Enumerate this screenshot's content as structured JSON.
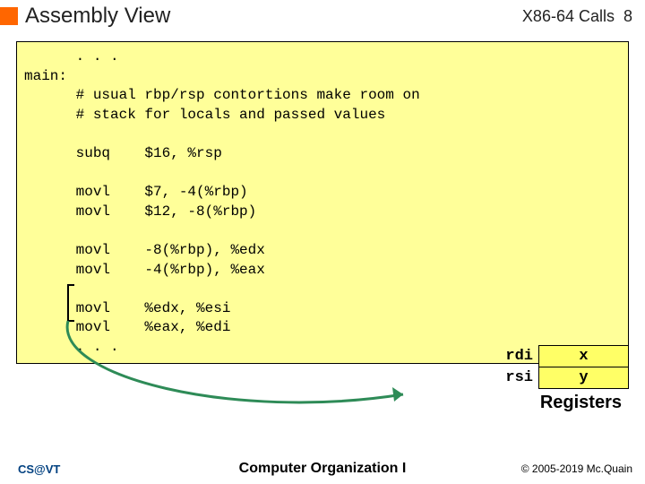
{
  "header": {
    "title": "Assembly View",
    "topic": "X86-64 Calls",
    "page": "8"
  },
  "code": {
    "lines": "      . . .\nmain:\n      # usual rbp/rsp contortions make room on\n      # stack for locals and passed values\n\n      subq    $16, %rsp\n\n      movl    $7, -4(%rbp)\n      movl    $12, -8(%rbp)\n\n      movl    -8(%rbp), %edx\n      movl    -4(%rbp), %eax\n\n      movl    %edx, %esi\n      movl    %eax, %edi\n      . . ."
  },
  "registers": {
    "label": "Registers",
    "rows": [
      {
        "reg": "rdi",
        "val": "x"
      },
      {
        "reg": "rsi",
        "val": "y"
      }
    ]
  },
  "footer": {
    "left": "CS@VT",
    "center": "Computer Organization I",
    "right": "© 2005-2019 Mc.Quain"
  }
}
